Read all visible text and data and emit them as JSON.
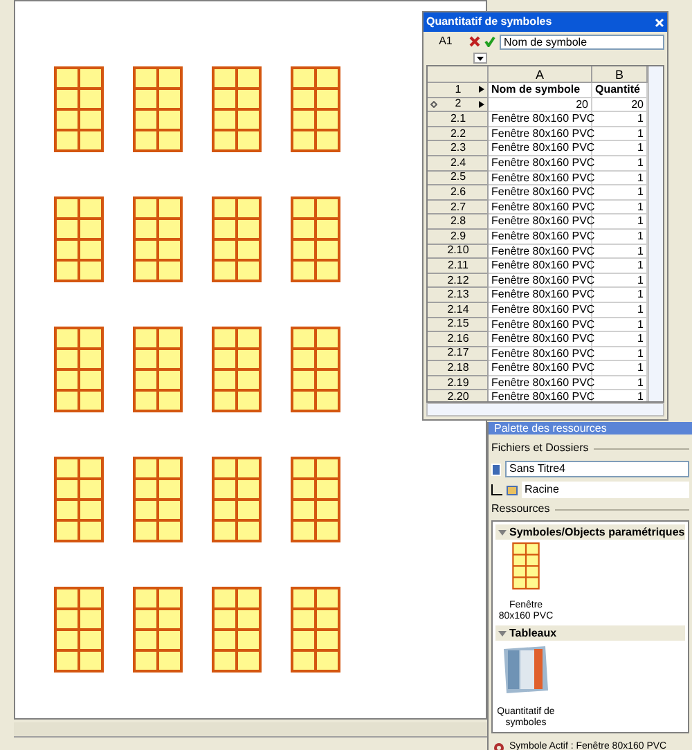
{
  "drawing": {
    "symbols": [
      {
        "kind": "window"
      },
      {
        "kind": "window"
      },
      {
        "kind": "window"
      },
      {
        "kind": "window"
      },
      {
        "kind": "window"
      },
      {
        "kind": "window"
      },
      {
        "kind": "window"
      },
      {
        "kind": "window"
      },
      {
        "kind": "window"
      },
      {
        "kind": "window"
      },
      {
        "kind": "window"
      },
      {
        "kind": "window"
      },
      {
        "kind": "window"
      },
      {
        "kind": "window"
      },
      {
        "kind": "window"
      },
      {
        "kind": "window"
      },
      {
        "kind": "window"
      },
      {
        "kind": "window"
      },
      {
        "kind": "window"
      },
      {
        "kind": "window"
      }
    ]
  },
  "spreadsheet": {
    "title": "Quantitatif de symboles",
    "cell_ref": "A1",
    "formula": "Nom de symbole",
    "columns": [
      "A",
      "B"
    ],
    "rows": [
      {
        "header": "1",
        "kind": "heading",
        "cells": [
          "Nom de symbole",
          "Quantité"
        ]
      },
      {
        "header": "2",
        "kind": "group",
        "cells": [
          "20",
          "20"
        ]
      },
      {
        "header": "2.1",
        "kind": "item",
        "cells": [
          "Fenêtre 80x160 PVC",
          "1"
        ]
      },
      {
        "header": "2.2",
        "kind": "item",
        "cells": [
          "Fenêtre 80x160 PVC",
          "1"
        ]
      },
      {
        "header": "2.3",
        "kind": "item",
        "cells": [
          "Fenêtre 80x160 PVC",
          "1"
        ]
      },
      {
        "header": "2.4",
        "kind": "item",
        "cells": [
          "Fenêtre 80x160 PVC",
          "1"
        ]
      },
      {
        "header": "2.5",
        "kind": "item",
        "cells": [
          "Fenêtre 80x160 PVC",
          "1"
        ]
      },
      {
        "header": "2.6",
        "kind": "item",
        "cells": [
          "Fenêtre 80x160 PVC",
          "1"
        ]
      },
      {
        "header": "2.7",
        "kind": "item",
        "cells": [
          "Fenêtre 80x160 PVC",
          "1"
        ]
      },
      {
        "header": "2.8",
        "kind": "item",
        "cells": [
          "Fenêtre 80x160 PVC",
          "1"
        ]
      },
      {
        "header": "2.9",
        "kind": "item",
        "cells": [
          "Fenêtre 80x160 PVC",
          "1"
        ]
      },
      {
        "header": "2.10",
        "kind": "item",
        "cells": [
          "Fenêtre 80x160 PVC",
          "1"
        ]
      },
      {
        "header": "2.11",
        "kind": "item",
        "cells": [
          "Fenêtre 80x160 PVC",
          "1"
        ]
      },
      {
        "header": "2.12",
        "kind": "item",
        "cells": [
          "Fenêtre 80x160 PVC",
          "1"
        ]
      },
      {
        "header": "2.13",
        "kind": "item",
        "cells": [
          "Fenêtre 80x160 PVC",
          "1"
        ]
      },
      {
        "header": "2.14",
        "kind": "item",
        "cells": [
          "Fenêtre 80x160 PVC",
          "1"
        ]
      },
      {
        "header": "2.15",
        "kind": "item",
        "cells": [
          "Fenêtre 80x160 PVC",
          "1"
        ]
      },
      {
        "header": "2.16",
        "kind": "item",
        "cells": [
          "Fenêtre 80x160 PVC",
          "1"
        ]
      },
      {
        "header": "2.17",
        "kind": "item",
        "cells": [
          "Fenêtre 80x160 PVC",
          "1"
        ]
      },
      {
        "header": "2.18",
        "kind": "item",
        "cells": [
          "Fenêtre 80x160 PVC",
          "1"
        ]
      },
      {
        "header": "2.19",
        "kind": "item",
        "cells": [
          "Fenêtre 80x160 PVC",
          "1"
        ]
      },
      {
        "header": "2.20",
        "kind": "item",
        "cells": [
          "Fenêtre 80x160 PVC",
          "1"
        ]
      }
    ]
  },
  "palette": {
    "title": "Palette des ressources",
    "files_label": "Fichiers et Dossiers",
    "file": "Sans Titre4",
    "folder": "Racine",
    "resources_label": "Ressources",
    "groups": [
      {
        "title": "Symboles/Objects paramétriques",
        "expanded": true,
        "items": [
          {
            "kind": "symbol",
            "label": "Fenêtre 80x160 PVC"
          }
        ]
      },
      {
        "title": "Tableaux",
        "expanded": true,
        "items": [
          {
            "kind": "table",
            "label": "Quantitatif de symboles"
          }
        ]
      }
    ],
    "status": "Symbole Actif : Fenêtre 80x160 PVC"
  }
}
